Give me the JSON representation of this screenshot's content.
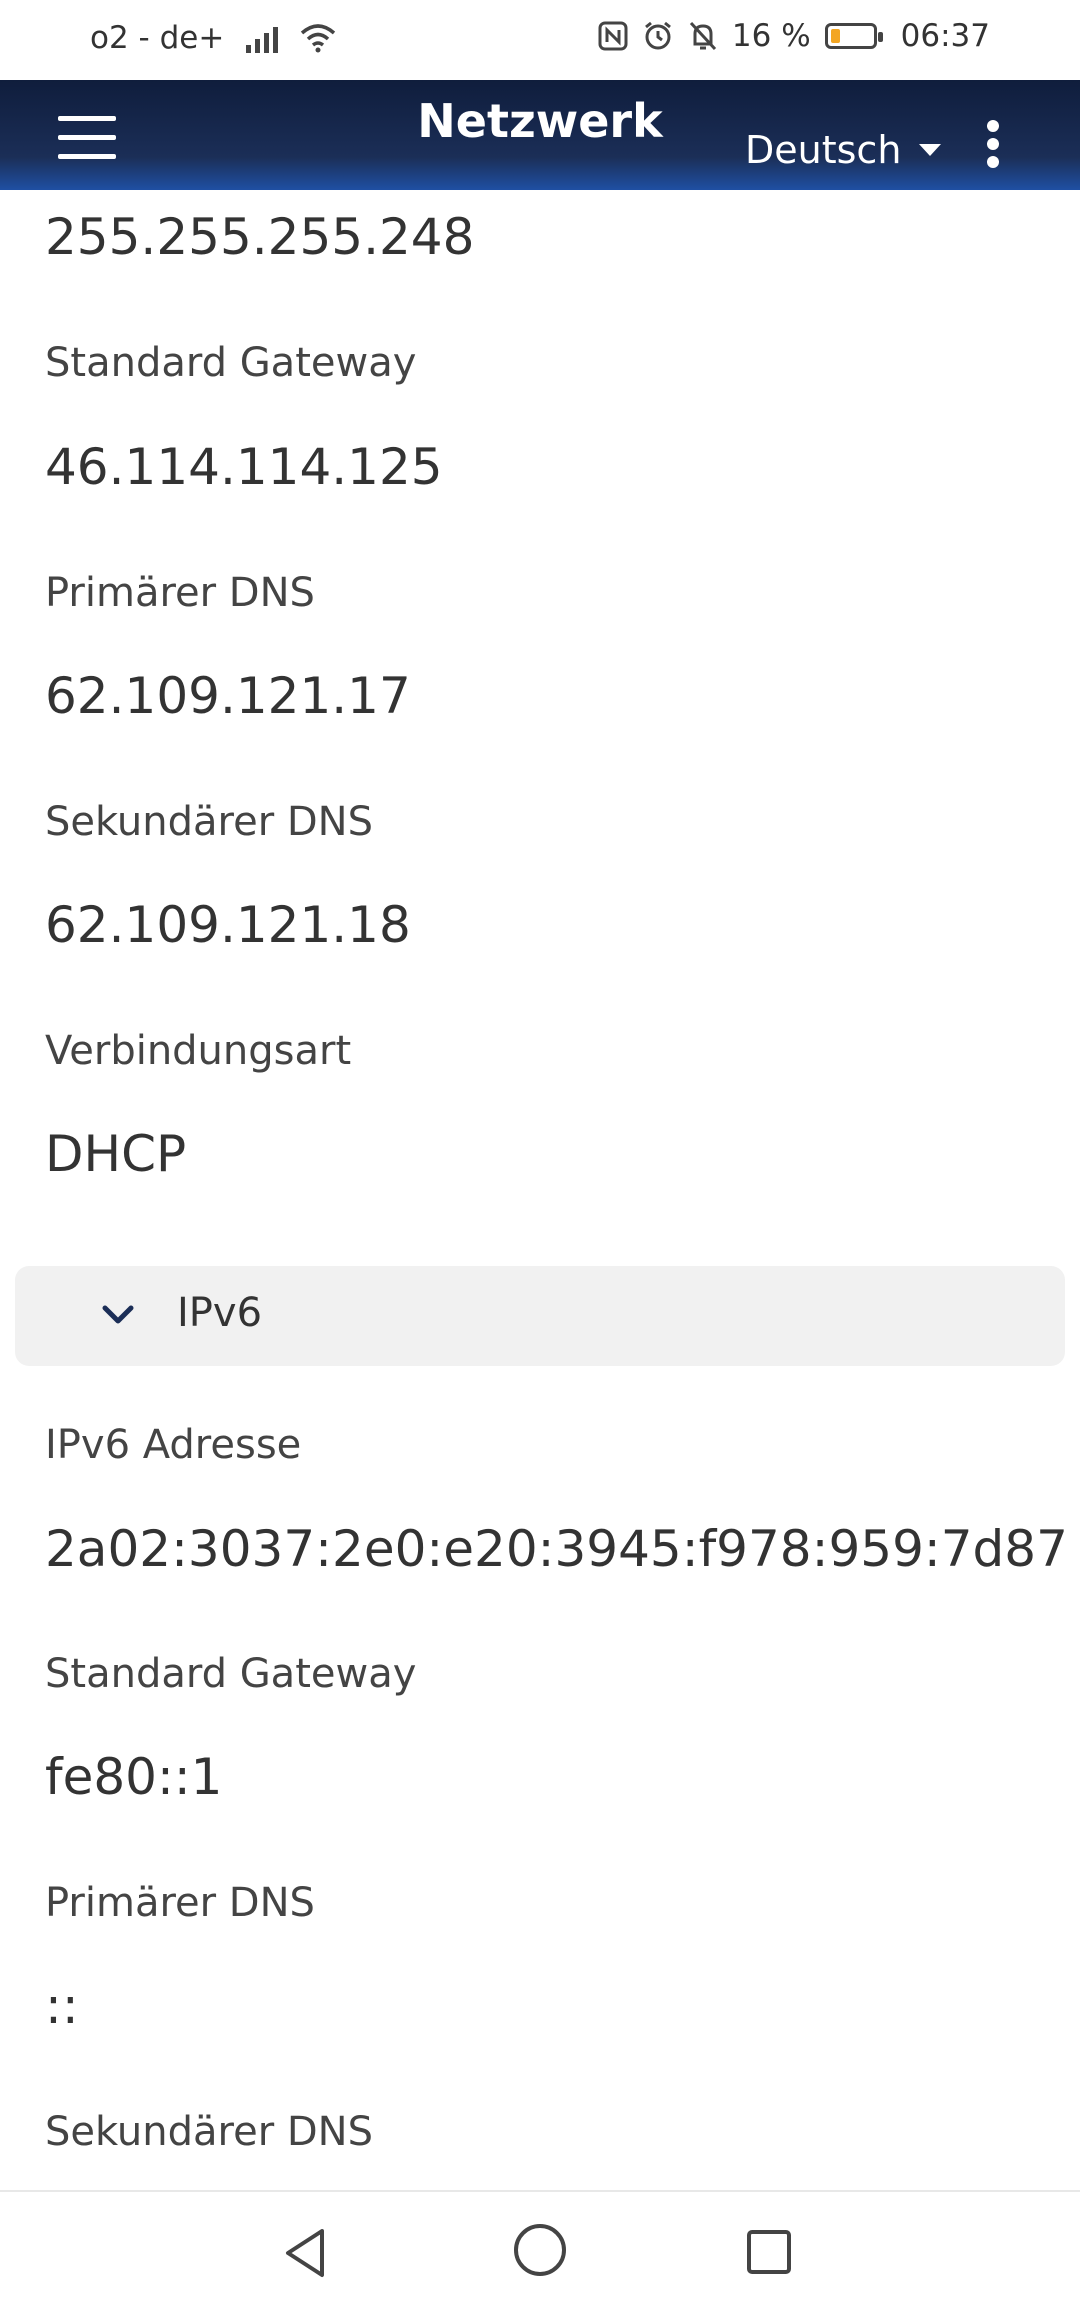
{
  "status_bar": {
    "carrier": "o2 - de+",
    "battery_percent": "16 %",
    "time": "06:37",
    "icons": [
      "signal-icon",
      "wifi-icon",
      "nfc-icon",
      "alarm-icon",
      "mute-icon",
      "battery-icon"
    ],
    "battery_color": "#f3a623"
  },
  "app_bar": {
    "title": "Netzwerk",
    "language": "Deutsch",
    "gradient_colors": [
      "#0f1d3c",
      "#1f4fa3"
    ]
  },
  "ipv4": {
    "subnet_value": "255.255.255.248",
    "gateway_label": "Standard Gateway",
    "gateway_value": "46.114.114.125",
    "primary_dns_label": "Primärer DNS",
    "primary_dns_value": "62.109.121.17",
    "secondary_dns_label": "Sekundärer DNS",
    "secondary_dns_value": "62.109.121.18",
    "connection_label": "Verbindungsart",
    "connection_value": "DHCP"
  },
  "ipv6_section": {
    "title": "IPv6",
    "address_label": "IPv6 Adresse",
    "address_value": "2a02:3037:2e0:e20:3945:f978:959:7d87",
    "gateway_label": "Standard Gateway",
    "gateway_value": "fe80::1",
    "primary_dns_label": "Primärer DNS",
    "primary_dns_value": "::",
    "secondary_dns_label": "Sekundärer DNS"
  }
}
